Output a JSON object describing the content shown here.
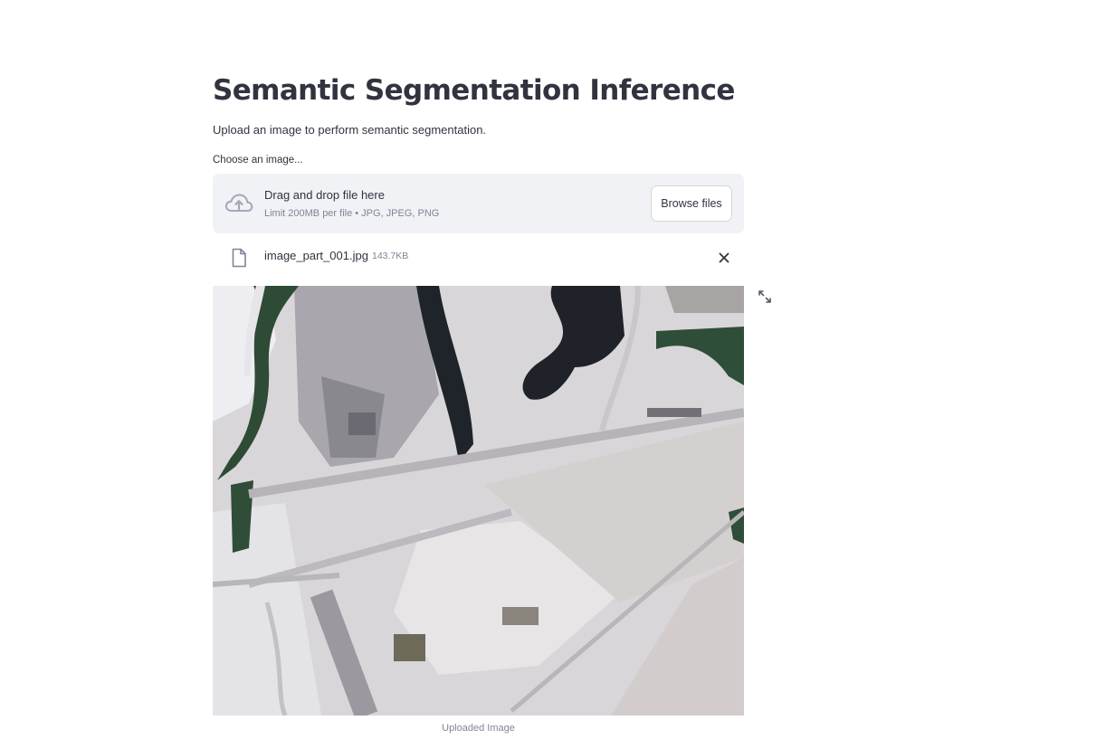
{
  "app": {
    "title": "Semantic Segmentation Inference",
    "description": "Upload an image to perform semantic segmentation."
  },
  "uploader": {
    "label": "Choose an image...",
    "drop_title": "Drag and drop file here",
    "drop_limit": "Limit 200MB per file • JPG, JPEG, PNG",
    "browse_label": "Browse files",
    "icon": "cloud-upload-icon"
  },
  "uploaded_file": {
    "name": "image_part_001.jpg",
    "size": "143.7KB",
    "icon": "file-icon",
    "remove_icon": "close-icon"
  },
  "image": {
    "caption": "Uploaded Image",
    "fullscreen_icon": "expand-icon"
  },
  "colors": {
    "text": "#31333f",
    "muted": "#808495",
    "dropzone_bg": "#f0f2f6",
    "border": "#d6d6d9"
  }
}
